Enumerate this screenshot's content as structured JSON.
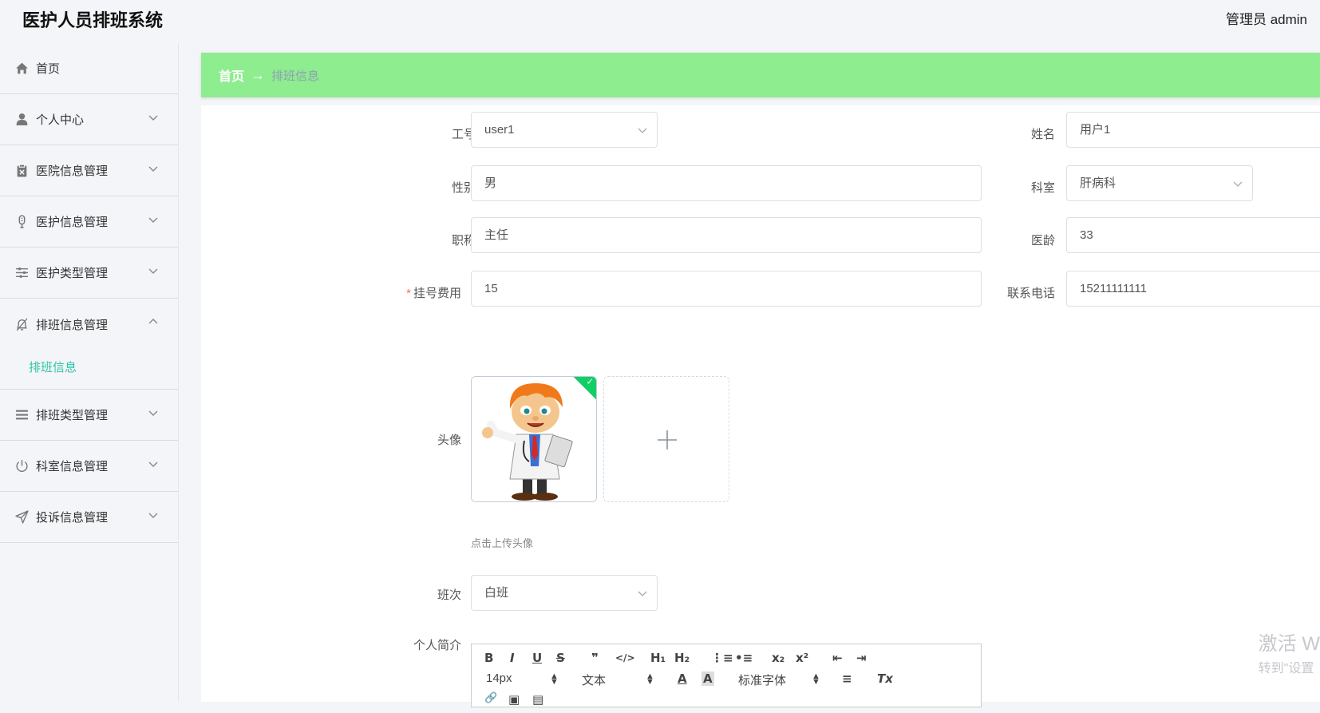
{
  "header": {
    "title": "医护人员排班系统",
    "user": "管理员 admin"
  },
  "sidebar": {
    "items": [
      {
        "label": "首页",
        "icon": "home-icon"
      },
      {
        "label": "个人中心",
        "icon": "user-icon"
      },
      {
        "label": "医院信息管理",
        "icon": "clipboard-icon"
      },
      {
        "label": "医护信息管理",
        "icon": "thermometer-icon"
      },
      {
        "label": "医护类型管理",
        "icon": "sliders-icon"
      },
      {
        "label": "排班信息管理",
        "icon": "bell-off-icon",
        "expanded": true,
        "children": [
          {
            "label": "排班信息",
            "active": true
          }
        ]
      },
      {
        "label": "排班类型管理",
        "icon": "list-icon"
      },
      {
        "label": "科室信息管理",
        "icon": "power-icon"
      },
      {
        "label": "投诉信息管理",
        "icon": "send-icon"
      }
    ],
    "active_color": "#2ec4a8"
  },
  "breadcrumb": {
    "home": "首页",
    "separator": "→",
    "current": "排班信息",
    "bar_color": "#8eed8e"
  },
  "form": {
    "gonghao": {
      "label": "工号",
      "value": "user1"
    },
    "xingming": {
      "label": "姓名",
      "value": "用户1"
    },
    "xingbie": {
      "label": "性别",
      "value": "男"
    },
    "keshi": {
      "label": "科室",
      "value": "肝病科"
    },
    "zhicheng": {
      "label": "职称",
      "value": "主任"
    },
    "yiling": {
      "label": "医龄",
      "value": "33"
    },
    "guahao": {
      "label": "挂号费用",
      "required_mark": "*",
      "value": "15"
    },
    "dianhua": {
      "label": "联系电话",
      "value": "15211111111"
    },
    "touxiang": {
      "label": "头像",
      "hint": "点击上传头像"
    },
    "banci": {
      "label": "班次",
      "value": "白班"
    },
    "jianjie": {
      "label": "个人简介",
      "toolbar": {
        "bold": "B",
        "italic": "I",
        "underline": "U",
        "strike": "S",
        "quote": "❞",
        "code": "</>",
        "h1": "H₁",
        "h2": "H₂",
        "ordered_list": "⋮≡",
        "bullet_list": "•≡",
        "subscript": "x₂",
        "superscript": "x²",
        "outdent": "⇤",
        "indent": "⇥",
        "size": "14px",
        "format": "文本",
        "font": "标准字体",
        "color": "A",
        "background": "A",
        "align": "≡",
        "clean": "Tx",
        "link": "🔗",
        "image": "▣",
        "video": "▤"
      }
    }
  },
  "watermark": {
    "line1": "激活 W",
    "line2": "转到\"设置"
  }
}
